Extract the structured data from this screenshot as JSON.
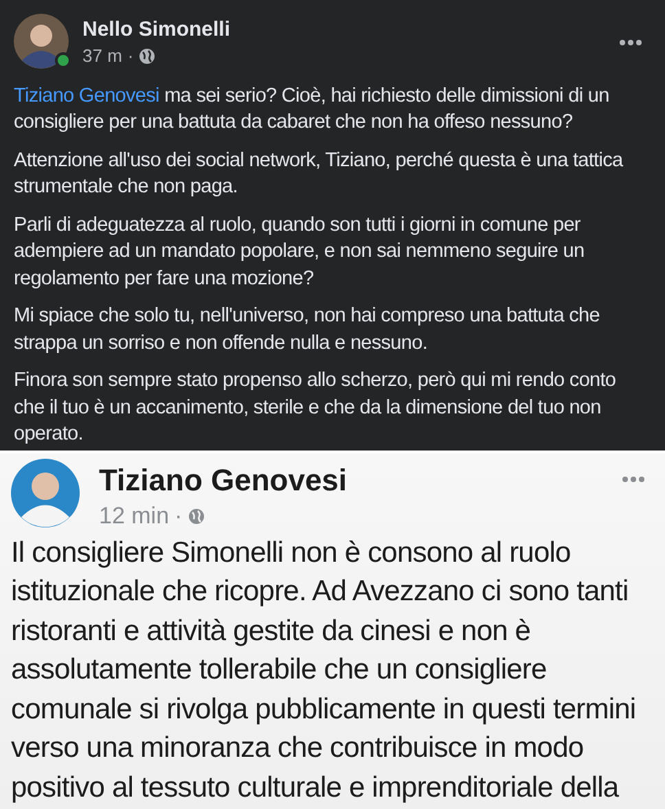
{
  "posts": [
    {
      "kind": "dark",
      "author": "Nello Simonelli",
      "time": "37 m",
      "separator": "·",
      "online": true,
      "paragraphs": [
        [
          {
            "kind": "mention",
            "text": "Tiziano Genovesi"
          },
          {
            "kind": "text",
            "text": " ma sei serio? Cioè, hai richiesto delle dimissioni di un consigliere per una battuta da cabaret che non ha offeso nessuno?"
          }
        ],
        [
          {
            "kind": "text",
            "text": "Attenzione all'uso dei social network, Tiziano, perché questa è una tattica strumentale che non paga."
          }
        ],
        [
          {
            "kind": "text",
            "text": "Parli di adeguatezza al ruolo, quando son tutti i giorni in comune per adempiere ad un mandato popolare, e non sai nemmeno seguire un regolamento per fare una mozione?"
          }
        ],
        [
          {
            "kind": "text",
            "text": "Mi spiace che solo tu, nell'universo, non hai compreso una battuta che strappa un sorriso e non offende nulla e nessuno."
          }
        ],
        [
          {
            "kind": "text",
            "text": "Finora son sempre stato propenso allo scherzo, però qui mi rendo conto che il tuo è un accanimento, sterile e che da la dimensione del tuo non operato."
          }
        ]
      ]
    },
    {
      "kind": "light",
      "author": "Tiziano Genovesi",
      "time": "12 min",
      "separator": "·",
      "online": false,
      "paragraphs": [
        [
          {
            "kind": "text",
            "text": "Il consigliere Simonelli non è consono al ruolo istituzionale che ricopre. Ad Avezzano ci sono tanti ristoranti e attività gestite da cinesi e non è assolutamente tollerabile che un consigliere comunale si rivolga pubblicamente in questi termini verso una minoranza che contribuisce in modo positivo al tessuto culturale e imprenditoriale della"
          }
        ]
      ]
    }
  ]
}
